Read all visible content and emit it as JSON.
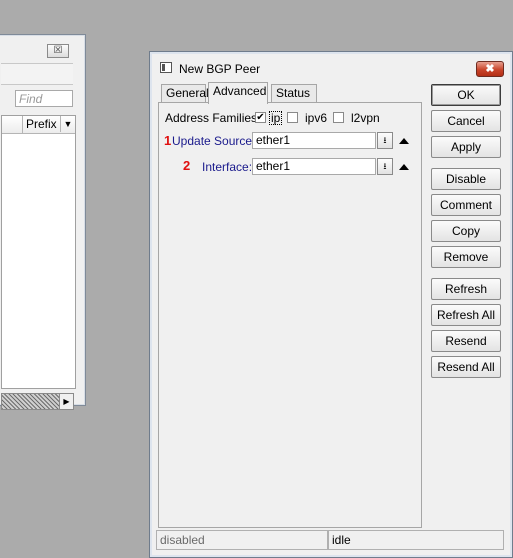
{
  "background_window": {
    "close_glyph": "☒",
    "find_placeholder": "Find",
    "column_header": "Prefix C",
    "scroll_arrow": "▶"
  },
  "dialog": {
    "title": "New BGP Peer",
    "close_glyph": "✖",
    "tabs": [
      {
        "label": "General"
      },
      {
        "label": "Advanced",
        "active": true
      },
      {
        "label": "Status"
      }
    ],
    "address_families": {
      "label": "Address Families:",
      "options": [
        {
          "label": "ip",
          "checked": true
        },
        {
          "label": "ipv6",
          "checked": false
        },
        {
          "label": "l2vpn",
          "checked": false
        }
      ]
    },
    "update_source": {
      "marker": "1",
      "label": "Update Source:",
      "value": "ether1"
    },
    "interface": {
      "marker": "2",
      "label": "Interface:",
      "value": "ether1"
    },
    "dropdown_glyph": "⭳",
    "buttons": {
      "ok": "OK",
      "cancel": "Cancel",
      "apply": "Apply",
      "disable": "Disable",
      "comment": "Comment",
      "copy": "Copy",
      "remove": "Remove",
      "refresh": "Refresh",
      "refresh_all": "Refresh All",
      "resend": "Resend",
      "resend_all": "Resend All"
    },
    "status_left": "disabled",
    "status_right": "idle"
  },
  "colors": {
    "desktop": "#ababab",
    "label_blue": "#1a1a8c",
    "marker_red": "#e01010",
    "close_red": "#c9452b"
  }
}
